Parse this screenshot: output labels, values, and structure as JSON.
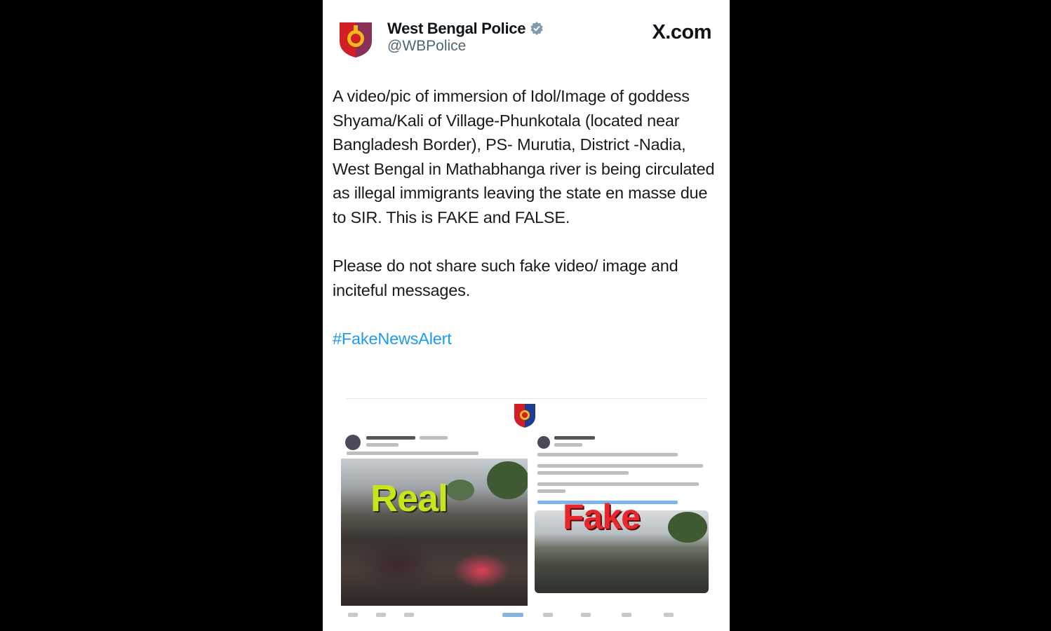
{
  "post": {
    "author_name": "West Bengal Police",
    "author_handle": "@WBPolice",
    "site": "X.com",
    "paragraphs": [
      "A video/pic of immersion of Idol/Image of goddess Shyama/Kali  of  Village-Phunkotala (located near Bangladesh Border), PS- Murutia, District -Nadia, West Bengal in Mathabhanga river is being circulated as illegal immigrants leaving the state en masse due to SIR. This is FAKE and FALSE.",
      "Please do not share such fake video/ image and inciteful messages."
    ],
    "hashtag": "#FakeNewsAlert"
  },
  "attached_image": {
    "real_label": "Real",
    "fake_label": "Fake"
  },
  "colors": {
    "hashtag": "#1d9bf0",
    "real_label": "#c7e51a",
    "fake_label": "#e8262c",
    "verified_badge": "#829aab"
  },
  "icons": {
    "avatar": "police-emblem-icon",
    "verified": "verified-badge-icon"
  }
}
